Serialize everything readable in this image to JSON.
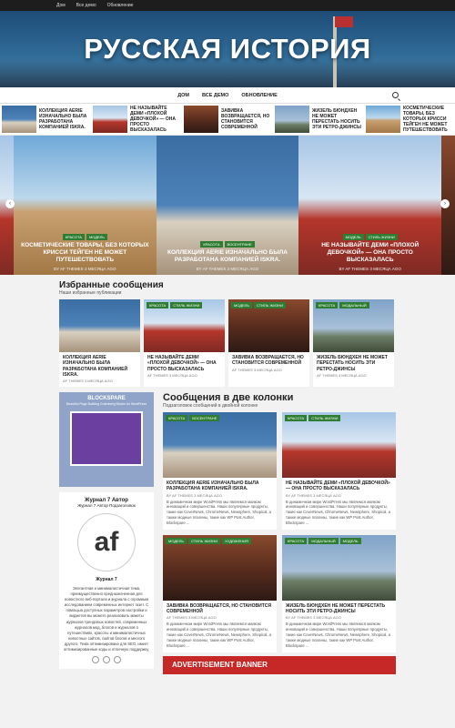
{
  "topbar": {
    "links": [
      "Дом",
      "Все демо",
      "Обновление"
    ]
  },
  "site": {
    "title": "РУССКАЯ ИСТОРИЯ"
  },
  "nav": {
    "items": [
      "ДОМ",
      "ВСЕ ДЕМО",
      "ОБНОВЛЕНИЕ"
    ]
  },
  "ticker": [
    "Коллекция Aerie изначально была разработана компанией Iskra.",
    "Не называйте Деми «плохой девочкой» — она просто высказалась",
    "Завивка возвращается, но становится современной",
    "Жизель Бюндхен не может перестать носить эти ретро-джинсы",
    "Косметические товары, без которых Крисси Тейген не может путешествовать"
  ],
  "slider": [
    {
      "tags": [
        "КРАСОТА",
        "МОДЕЛЬ"
      ],
      "title": "КОСМЕТИЧЕСКИЕ ТОВАРЫ, БЕЗ КОТОРЫХ КРИССИ ТЕЙГЕН НЕ МОЖЕТ ПУТЕШЕСТВОВАТЬ",
      "author": "BY AF THEMES",
      "date": "3 МЕСЯЦА AGO"
    },
    {
      "tags": [
        "КРАСОТА",
        "ВОСЕНТРАНЕ"
      ],
      "title": "КОЛЛЕКЦИЯ AERIE ИЗНАЧАЛЬНО БЫЛА РАЗРАБОТАНА КОМПАНИЕЙ ISKRA.",
      "author": "BY AF THEMES",
      "date": "3 МЕСЯЦА AGO"
    },
    {
      "tags": [
        "МОДЕЛЬ",
        "СТИЛЬ ЖИЗНИ"
      ],
      "title": "НЕ НАЗЫВАЙТЕ ДЕМИ «ПЛОХОЙ ДЕВОЧКОЙ» — ОНА ПРОСТО ВЫСКАЗАЛАСЬ",
      "author": "BY AF THEMES",
      "date": "3 МЕСЯЦА AGO"
    }
  ],
  "featured": {
    "heading": "Избранные сообщения",
    "subheading": "Наши избранные публикации",
    "cards": [
      {
        "tags": [],
        "title": "КОЛЛЕКЦИЯ AERIE ИЗНАЧАЛЬНО БЫЛА РАЗРАБОТАНА КОМПАНИЕЙ ISKRA.",
        "author": "AF THEMES",
        "date": "3 МЕСЯЦА AGO"
      },
      {
        "tags": [
          "КРАСОТА",
          "СТИЛЬ ЖИЗНИ"
        ],
        "title": "НЕ НАЗЫВАЙТЕ ДЕМИ «ПЛОХОЙ ДЕВОЧКОЙ» — ОНА ПРОСТО ВЫСКАЗАЛАСЬ",
        "author": "AF THEMES",
        "date": "3 МЕСЯЦА AGO"
      },
      {
        "tags": [
          "МОДЕЛЬ",
          "СТИЛЬ ЖИЗНИ"
        ],
        "title": "ЗАВИВКА ВОЗВРАЩАЕТСЯ, НО СТАНОВИТСЯ СОВРЕМЕННОЙ",
        "author": "AF THEMES",
        "date": "3 МЕСЯЦА AGO"
      },
      {
        "tags": [
          "КРАСОТА",
          "МОДАЛЬНЫЙ"
        ],
        "title": "ЖИЗЕЛЬ БЮНДХЕН НЕ МОЖЕТ ПЕРЕСТАТЬ НОСИТЬ ЭТИ РЕТРО-ДЖИНСЫ",
        "author": "AF THEMES",
        "date": "3 МЕСЯЦА AGO"
      }
    ]
  },
  "ad": {
    "brand": "BLOCKSPARE",
    "tagline": "Beautiful Page Building Gutenberg Blocks for WordPress"
  },
  "author": {
    "heading": "Журнал 7 Автор",
    "subheading": "Журнал 7 Автор Подзаголовок",
    "name": "Журнал 7",
    "bio": "Элегантная и минималистичная тема, преимущественно предназначенная для новостного веб-портала и журнала с огромным исследованием современных интернет газет. С помощью доступных параметров настройки и виджетов вы можете реализовать макеты журналов трендовых новостей, современных журналов мод, блогов и журналов о путешествиях, красоты и минималистичных новостных сайтов, сайтов блогов и многого другого. Тема оптимизирована для SEO, имеет оптимизированные коды и отличную поддержку."
  },
  "two_col": {
    "heading": "Сообщения в две колонки",
    "subheading": "Подзаголовок сообщений в двойной колонке",
    "excerpt": "В динамичном мире WordPress мы являемся маяком инноваций и совершенства. Наши популярные продукты, такие как CoverNews, ChromeNews, Newsphere, Shopical, а также модные плагины, такие как WP Post Author, Blockspare ...",
    "cards": [
      {
        "tags": [
          "КРАСОТА",
          "ВОСЕНТРАНЕ"
        ],
        "title": "КОЛЛЕКЦИЯ AERIE ИЗНАЧАЛЬНО БЫЛА РАЗРАБОТАНА КОМПАНИЕЙ ISKRA.",
        "author": "BY AF THEMES",
        "date": "3 МЕСЯЦА AGO"
      },
      {
        "tags": [
          "КРАСОТА",
          "СТИЛЬ ЖИЗНИ"
        ],
        "title": "НЕ НАЗЫВАЙТЕ ДЕМИ «ПЛОХОЙ ДЕВОЧКОЙ» — ОНА ПРОСТО ВЫСКАЗАЛАСЬ",
        "author": "BY AF THEMES",
        "date": "3 МЕСЯЦА AGO"
      },
      {
        "tags": [
          "МОДЕЛЬ",
          "СТИЛЬ ЖИЗНИ",
          "ХУДОЖЕНИЯ"
        ],
        "title": "ЗАВИВКА ВОЗВРАЩАЕТСЯ, НО СТАНОВИТСЯ СОВРЕМЕННОЙ",
        "author": "AF THEMES",
        "date": "3 МЕСЯЦА AGO"
      },
      {
        "tags": [
          "КРАСОТА",
          "МОДАЛЬНЫЙ",
          "МОДЕЛЬ"
        ],
        "title": "ЖИЗЕЛЬ БЮНДХЕН НЕ МОЖЕТ ПЕРЕСТАТЬ НОСИТЬ ЭТИ РЕТРО-ДЖИНСЫ",
        "author": "BY AF THEMES",
        "date": "3 МЕСЯЦА AGO"
      }
    ]
  },
  "banner": {
    "text": "ADVERTISEMENT BANNER"
  },
  "colors": {
    "tag": "#2e7d32",
    "accent": "#c62828",
    "topbar": "#1d1d1d"
  }
}
